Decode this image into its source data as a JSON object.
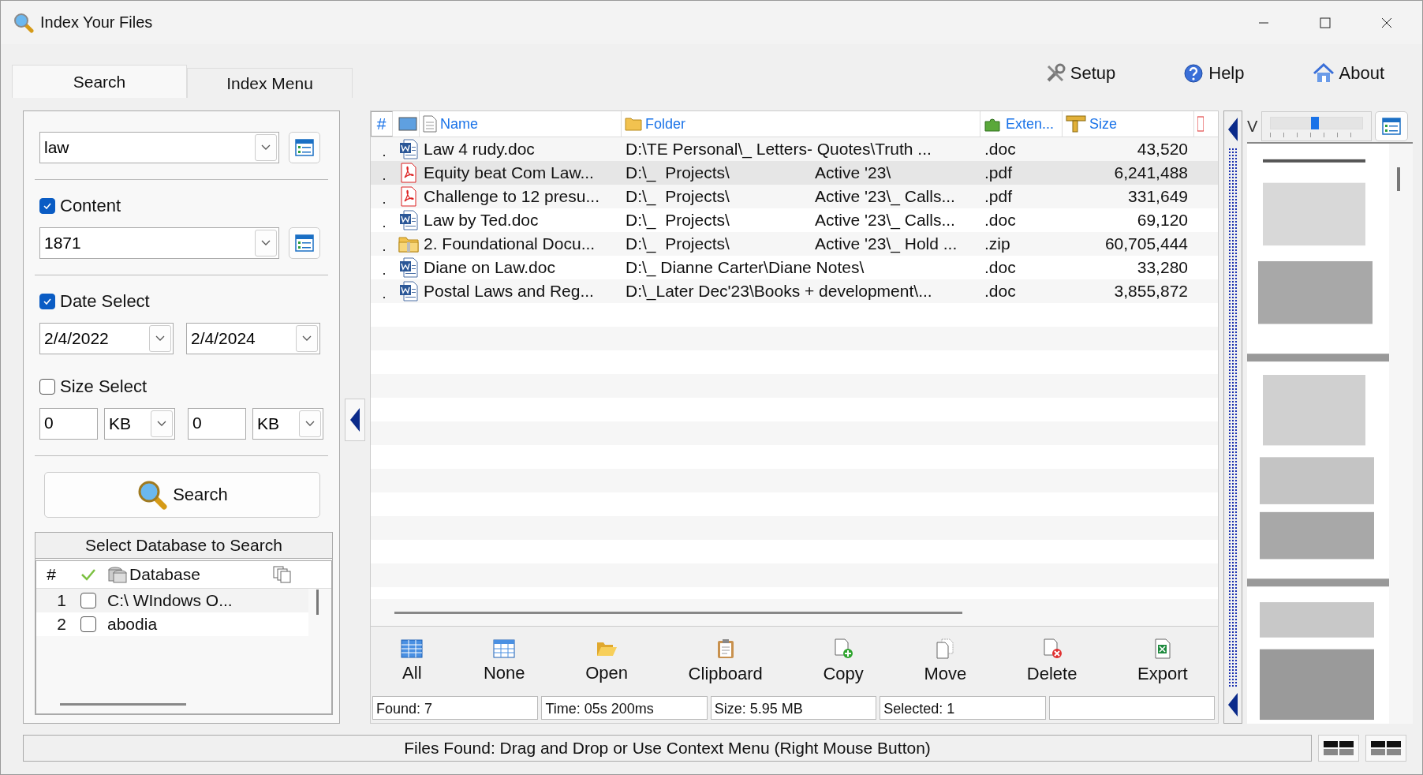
{
  "window": {
    "title": "Index Your Files"
  },
  "tabs": [
    {
      "label": "Search",
      "selected": true
    },
    {
      "label": "Index Menu",
      "selected": false
    }
  ],
  "top_buttons": [
    {
      "kind": "setup",
      "label": "Setup"
    },
    {
      "kind": "help",
      "label": "Help"
    },
    {
      "kind": "about",
      "label": "About"
    }
  ],
  "search": {
    "query": "law",
    "content": {
      "label": "Content",
      "checked": true,
      "value": "1871"
    },
    "date": {
      "label": "Date Select",
      "checked": true,
      "from": "2/4/2022",
      "to": "2/4/2024"
    },
    "size": {
      "label": "Size Select",
      "checked": false,
      "min": "0",
      "min_unit": "KB",
      "max": "0",
      "max_unit": "KB"
    },
    "button": "Search"
  },
  "databases": {
    "title": "Select Database to Search",
    "columns": [
      "#",
      "Database"
    ],
    "rows": [
      {
        "num": "1",
        "checked": false,
        "name": "C:\\ WIndows O..."
      },
      {
        "num": "2",
        "checked": false,
        "name": "abodia"
      }
    ]
  },
  "results": {
    "columns": [
      {
        "kind": "num",
        "label": "#"
      },
      {
        "kind": "icon"
      },
      {
        "kind": "name",
        "label": "Name"
      },
      {
        "kind": "folder",
        "label": "Folder"
      },
      {
        "kind": "ext",
        "label": "Exten..."
      },
      {
        "kind": "size",
        "label": "Size"
      }
    ],
    "rows": [
      {
        "kind": "doc",
        "name": "Law 4 rudy.doc",
        "folder": "D:\\TE Personal\\_ Letters- Quotes\\Truth ...",
        "ext": ".doc",
        "size": "43,520",
        "selected": false
      },
      {
        "kind": "pdf",
        "name": "Equity beat Com Law...",
        "folder": "D:\\_  Projects\\\tActive '23\\",
        "ext": ".pdf",
        "size": "6,241,488",
        "selected": true
      },
      {
        "kind": "pdf",
        "name": "Challenge to 12 presu...",
        "folder": "D:\\_  Projects\\\tActive '23\\_ Calls...",
        "ext": ".pdf",
        "size": "331,649",
        "selected": false
      },
      {
        "kind": "doc",
        "name": "Law by Ted.doc",
        "folder": "D:\\_  Projects\\\tActive '23\\_ Calls...",
        "ext": ".doc",
        "size": "69,120",
        "selected": false
      },
      {
        "kind": "zip",
        "name": "2. Foundational Docu...",
        "folder": "D:\\_  Projects\\\tActive '23\\_ Hold ...",
        "ext": ".zip",
        "size": "60,705,444",
        "selected": false
      },
      {
        "kind": "doc",
        "name": "Diane on Law.doc",
        "folder": "D:\\_ Dianne Carter\\Diane Notes\\",
        "ext": ".doc",
        "size": "33,280",
        "selected": false
      },
      {
        "kind": "doc",
        "name": "Postal Laws and Reg...",
        "folder": "D:\\_Later Dec'23\\Books + development\\...",
        "ext": ".doc",
        "size": "3,855,872",
        "selected": false
      }
    ]
  },
  "actions": [
    {
      "kind": "all",
      "label": "All"
    },
    {
      "kind": "none",
      "label": "None"
    },
    {
      "kind": "open",
      "label": "Open"
    },
    {
      "kind": "clipboard",
      "label": "Clipboard"
    },
    {
      "kind": "copy",
      "label": "Copy"
    },
    {
      "kind": "move",
      "label": "Move"
    },
    {
      "kind": "delete",
      "label": "Delete"
    },
    {
      "kind": "export",
      "label": "Export"
    }
  ],
  "stats": [
    "Found: 7",
    "Time: 05s 200ms",
    "Size: 5.95 MB",
    "Selected: 1"
  ],
  "preview": {
    "label": "V",
    "zoom": {
      "level": 0.48
    }
  },
  "status_bar": "Files Found: Drag and Drop or Use Context Menu (Right Mouse Button)"
}
